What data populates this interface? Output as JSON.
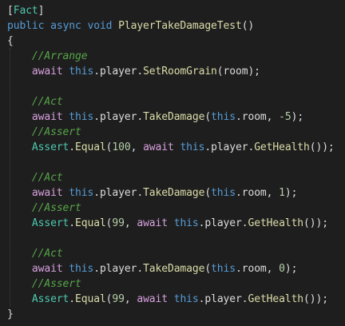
{
  "code": {
    "attribute": "Fact",
    "modifiers": [
      "public",
      "async",
      "void"
    ],
    "method_name": "PlayerTakeDamageTest",
    "comments": {
      "arrange": "//Arrange",
      "act": "//Act",
      "assert": "//Assert"
    },
    "keywords": {
      "await": "await",
      "this": "this"
    },
    "identifiers": {
      "player": "player",
      "room": "room",
      "assert_class": "Assert"
    },
    "methods": {
      "set_room_grain": "SetRoomGrain",
      "take_damage": "TakeDamage",
      "equal": "Equal",
      "get_health": "GetHealth"
    },
    "values": {
      "damage_1": "-5",
      "expected_1": "100",
      "damage_2": "1",
      "expected_2": "99",
      "damage_3": "0",
      "expected_3": "99"
    }
  }
}
